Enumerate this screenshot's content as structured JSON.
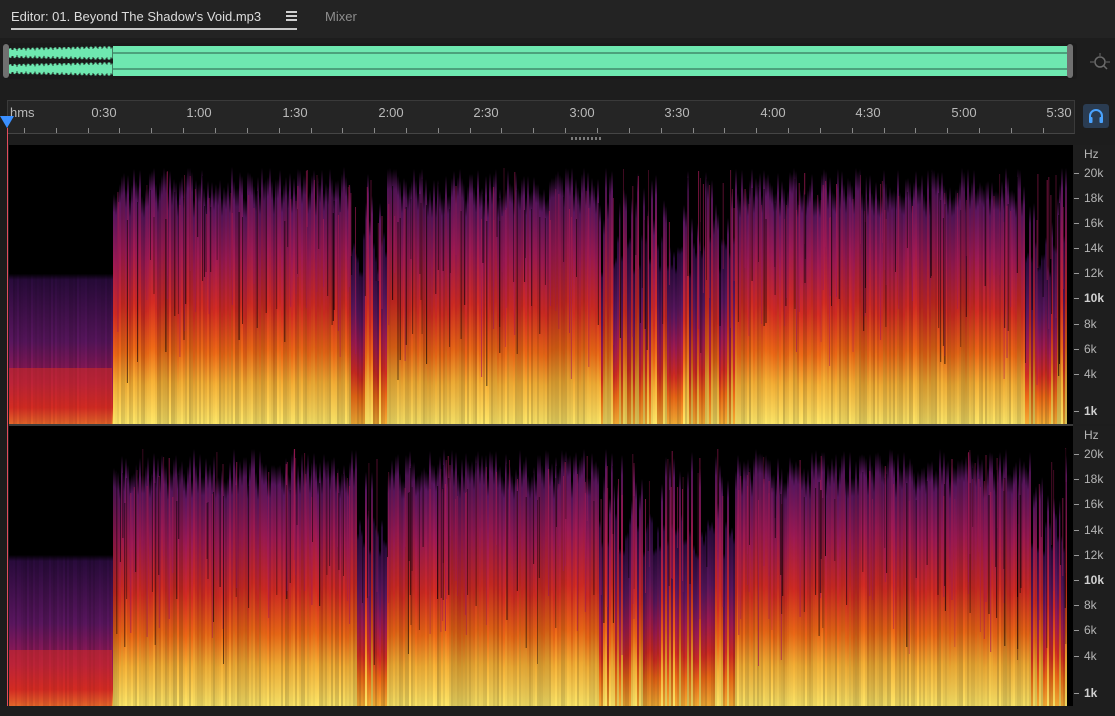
{
  "tabs": {
    "editor_label": "Editor: 01. Beyond The Shadow's Void.mp3",
    "mixer_label": "Mixer"
  },
  "overview": {
    "waveform_color": "#6ee8b0",
    "handle_color": "#707070"
  },
  "timeline": {
    "unit": "hms",
    "marks": [
      "0:30",
      "1:00",
      "1:30",
      "2:00",
      "2:30",
      "3:00",
      "3:30",
      "4:00",
      "4:30",
      "5:00",
      "5:30"
    ]
  },
  "playhead_color": "#3a8fff",
  "frequency_scale": {
    "unit": "Hz",
    "labels": [
      "20k",
      "18k",
      "16k",
      "14k",
      "12k",
      "10k",
      "8k",
      "6k",
      "4k",
      "1k"
    ]
  },
  "spectrogram": {
    "palette": [
      "#000000",
      "#2a0b3d",
      "#5b1660",
      "#a11a55",
      "#d52b23",
      "#f06a16",
      "#f9b236",
      "#ffe96a"
    ],
    "channels": [
      "channel-1",
      "channel-2"
    ]
  },
  "icons": {
    "menu": "hamburger-menu-icon",
    "zoom": "zoom-navigator-icon",
    "monitor": "headphones-icon"
  }
}
